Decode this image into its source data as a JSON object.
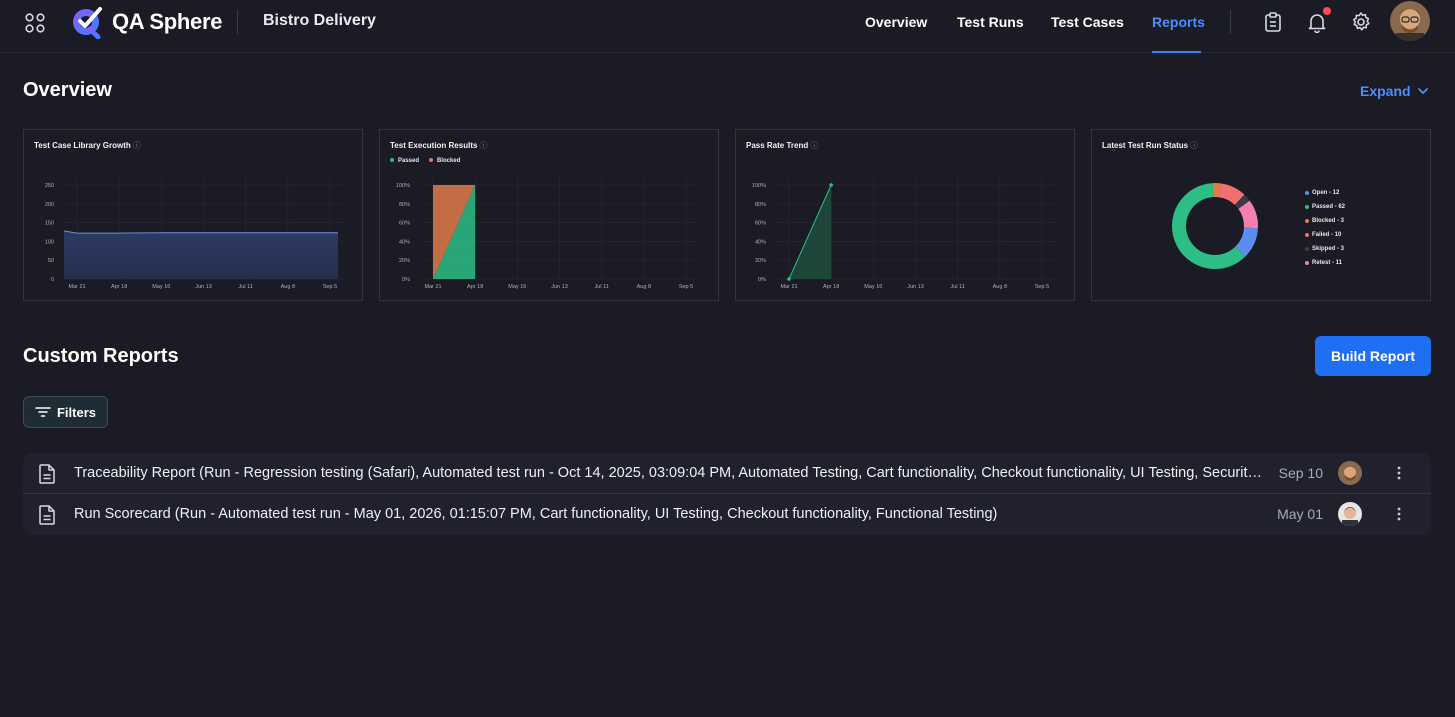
{
  "app": {
    "name": "QA Sphere",
    "project": "Bistro Delivery"
  },
  "nav": {
    "overview": "Overview",
    "test_runs": "Test Runs",
    "test_cases": "Test Cases",
    "reports": "Reports"
  },
  "overview": {
    "title": "Overview",
    "expand_label": "Expand",
    "cards": {
      "growth": {
        "title": "Test Case Library Growth",
        "info": "ⓘ"
      },
      "execution": {
        "title": "Test Execution Results",
        "info": "ⓘ"
      },
      "passrate": {
        "title": "Pass Rate Trend",
        "info": "ⓘ"
      },
      "status": {
        "title": "Latest Test Run Status",
        "info": "ⓘ"
      }
    }
  },
  "chart_data": [
    {
      "type": "area",
      "title": "Test Case Library Growth",
      "x_ticks": [
        "Mar 21",
        "Apr 18",
        "May 16",
        "Jun 13",
        "Jul 11",
        "Aug 8",
        "Sep 5"
      ],
      "y_ticks": [
        "250",
        "200",
        "150",
        "100",
        "50",
        "0"
      ],
      "ylim": [
        0,
        250
      ],
      "x": [
        "Mar 14",
        "Mar 21",
        "Mar 28",
        "Apr 18",
        "May 16",
        "Jun 13",
        "Jul 11",
        "Aug 8",
        "Sep 5",
        "Sep 12"
      ],
      "values": [
        128,
        122,
        122,
        122,
        123,
        123,
        123,
        123,
        123,
        123
      ],
      "grid": true,
      "colors": {
        "line": "#6b8fd6",
        "fill": "#2c3b63"
      }
    },
    {
      "type": "area",
      "title": "Test Execution Results",
      "x_ticks": [
        "Mar 21",
        "Apr 18",
        "May 16",
        "Jun 13",
        "Jul 11",
        "Aug 8",
        "Sep 5"
      ],
      "y_ticks": [
        "100%",
        "80%",
        "60%",
        "40%",
        "20%",
        "0%"
      ],
      "ylim": [
        0,
        100
      ],
      "x": [
        "Mar 21",
        "Apr 18"
      ],
      "series": [
        {
          "name": "Passed",
          "values": [
            0,
            100
          ],
          "color": "#2dbd85"
        },
        {
          "name": "Blocked",
          "values": [
            100,
            0
          ],
          "color": "#e07b4a"
        }
      ],
      "legend": "top-left",
      "grid": true
    },
    {
      "type": "line",
      "title": "Pass Rate Trend",
      "x_ticks": [
        "Mar 21",
        "Apr 18",
        "May 16",
        "Jun 13",
        "Jul 11",
        "Aug 8",
        "Sep 5"
      ],
      "y_ticks": [
        "100%",
        "80%",
        "60%",
        "40%",
        "20%",
        "0%"
      ],
      "ylim": [
        0,
        100
      ],
      "x": [
        "Mar 21",
        "Apr 18"
      ],
      "values": [
        0,
        100
      ],
      "grid": true,
      "colors": {
        "line": "#2dbd85",
        "fill": "#1f4a3c"
      }
    },
    {
      "type": "pie",
      "title": "Latest Test Run Status",
      "donut": true,
      "slices": [
        {
          "label": "Open",
          "value": 12,
          "legend": "Open - 12",
          "color": "#5b8def"
        },
        {
          "label": "Passed",
          "value": 62,
          "legend": "Passed - 62",
          "color": "#2dbd85"
        },
        {
          "label": "Blocked",
          "value": 3,
          "legend": "Blocked - 3",
          "color": "#e07b4a"
        },
        {
          "label": "Failed",
          "value": 10,
          "legend": "Failed - 10",
          "color": "#f06f6f"
        },
        {
          "label": "Skipped",
          "value": 3,
          "legend": "Skipped - 3",
          "color": "#3a3b48"
        },
        {
          "label": "Retest",
          "value": 11,
          "legend": "Retest - 11",
          "color": "#f47fb0"
        }
      ],
      "legend": "right"
    }
  ],
  "custom_reports": {
    "title": "Custom Reports",
    "build_label": "Build Report",
    "filters_label": "Filters",
    "rows": [
      {
        "title": "Traceability Report (Run - Regression testing (Safari), Automated test run - Oct 14, 2025, 03:09:04 PM, Automated Testing, Cart functionality, Checkout functionality, UI Testing, Security Testing)",
        "date": "Sep 10"
      },
      {
        "title": "Run Scorecard (Run - Automated test run - May 01, 2026, 01:15:07 PM, Cart functionality, UI Testing, Checkout functionality, Functional Testing)",
        "date": "May 01"
      }
    ]
  }
}
